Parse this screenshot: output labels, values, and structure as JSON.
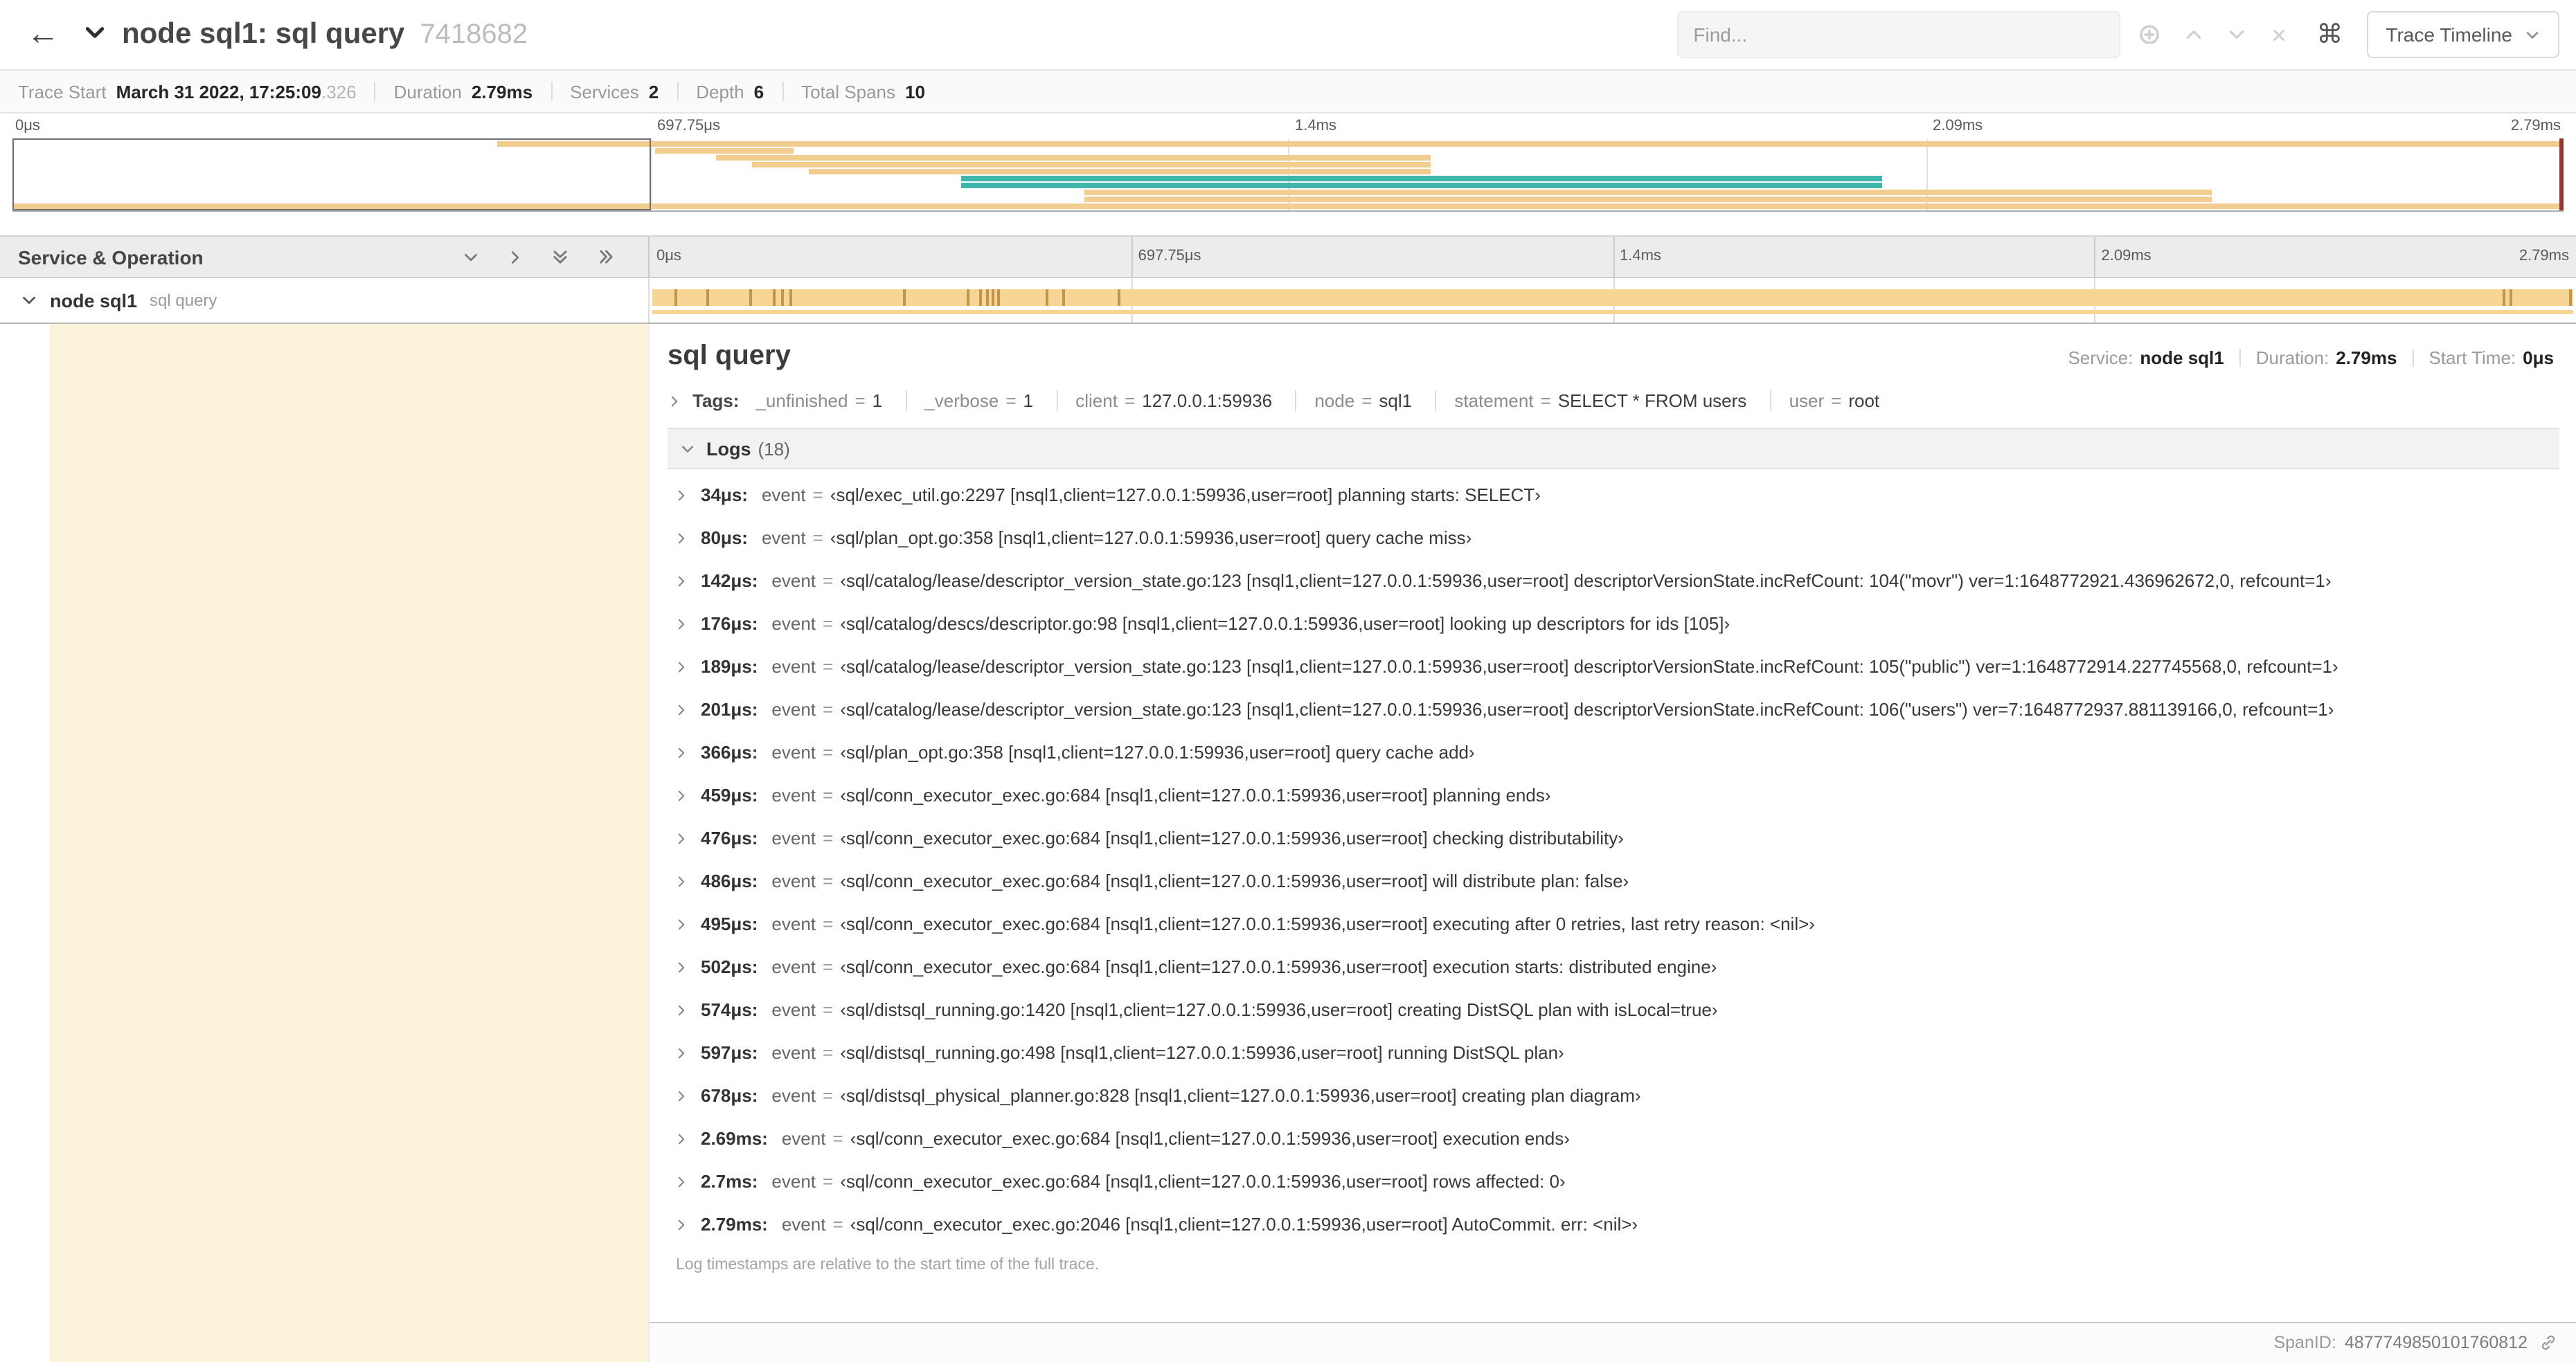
{
  "header": {
    "back_icon": "←",
    "title": "node sql1: sql query",
    "trace_id": "7418682",
    "find_placeholder": "Find...",
    "shortcuts_icon": "⌘",
    "view_selector": "Trace Timeline"
  },
  "summary": {
    "items": [
      {
        "label": "Trace Start",
        "value": "March 31 2022, 17:25:09",
        "suffix": ".326"
      },
      {
        "label": "Duration",
        "value": "2.79ms"
      },
      {
        "label": "Services",
        "value": "2"
      },
      {
        "label": "Depth",
        "value": "6"
      },
      {
        "label": "Total Spans",
        "value": "10"
      }
    ]
  },
  "timeline": {
    "service_operation_label": "Service & Operation",
    "ticks": [
      "0μs",
      "697.75μs",
      "1.4ms",
      "2.09ms",
      "2.79ms"
    ]
  },
  "minimap": {
    "selection": {
      "left_pct": 0,
      "width_pct": 25
    },
    "bars": [
      {
        "start": 19,
        "end": 100,
        "color": "#f2cd90"
      },
      {
        "start": 25.2,
        "end": 30.6,
        "color": "#f2cd90"
      },
      {
        "start": 27.6,
        "end": 55.6,
        "color": "#f2cd90"
      },
      {
        "start": 29.0,
        "end": 55.6,
        "color": "#f2cd90"
      },
      {
        "start": 31.2,
        "end": 55.6,
        "color": "#f2cd90"
      },
      {
        "start": 37.2,
        "end": 73.3,
        "color": "#3fb5ac"
      },
      {
        "start": 37.2,
        "end": 73.3,
        "color": "#3fb5ac"
      },
      {
        "start": 42.0,
        "end": 86.2,
        "color": "#f2cd90"
      },
      {
        "start": 42.0,
        "end": 86.2,
        "color": "#f2cd90"
      },
      {
        "start": 0,
        "end": 100,
        "color": "#f2cd90"
      }
    ]
  },
  "span_row": {
    "service": "node sql1",
    "operation": "sql query",
    "bar_color": "#f6d595",
    "tick_color": "#c0954c",
    "tick_pcts": [
      1.22,
      2.87,
      5.09,
      6.31,
      6.77,
      7.2,
      13.12,
      16.45,
      17.06,
      17.42,
      17.74,
      18.0,
      20.57,
      21.4,
      24.3,
      96.42,
      96.77,
      99.85
    ]
  },
  "detail": {
    "title": "sql query",
    "meta": [
      {
        "label": "Service:",
        "value": "node sql1"
      },
      {
        "label": "Duration:",
        "value": "2.79ms"
      },
      {
        "label": "Start Time:",
        "value": "0μs"
      }
    ],
    "tags_label": "Tags:",
    "tags": [
      {
        "key": "_unfinished",
        "value": "1"
      },
      {
        "key": "_verbose",
        "value": "1"
      },
      {
        "key": "client",
        "value": "127.0.0.1:59936"
      },
      {
        "key": "node",
        "value": "sql1"
      },
      {
        "key": "statement",
        "value": "SELECT * FROM users"
      },
      {
        "key": "user",
        "value": "root"
      }
    ],
    "logs_label": "Logs",
    "logs_count": "(18)",
    "logs": [
      {
        "time": "34μs:",
        "field": "event",
        "value": "‹sql/exec_util.go:2297 [nsql1,client=127.0.0.1:59936,user=root] planning starts: SELECT›"
      },
      {
        "time": "80μs:",
        "field": "event",
        "value": "‹sql/plan_opt.go:358 [nsql1,client=127.0.0.1:59936,user=root] query cache miss›"
      },
      {
        "time": "142μs:",
        "field": "event",
        "value": "‹sql/catalog/lease/descriptor_version_state.go:123 [nsql1,client=127.0.0.1:59936,user=root] descriptorVersionState.incRefCount: 104(\"movr\") ver=1:1648772921.436962672,0, refcount=1›"
      },
      {
        "time": "176μs:",
        "field": "event",
        "value": "‹sql/catalog/descs/descriptor.go:98 [nsql1,client=127.0.0.1:59936,user=root] looking up descriptors for ids [105]›"
      },
      {
        "time": "189μs:",
        "field": "event",
        "value": "‹sql/catalog/lease/descriptor_version_state.go:123 [nsql1,client=127.0.0.1:59936,user=root] descriptorVersionState.incRefCount: 105(\"public\") ver=1:1648772914.227745568,0, refcount=1›"
      },
      {
        "time": "201μs:",
        "field": "event",
        "value": "‹sql/catalog/lease/descriptor_version_state.go:123 [nsql1,client=127.0.0.1:59936,user=root] descriptorVersionState.incRefCount: 106(\"users\") ver=7:1648772937.881139166,0, refcount=1›"
      },
      {
        "time": "366μs:",
        "field": "event",
        "value": "‹sql/plan_opt.go:358 [nsql1,client=127.0.0.1:59936,user=root] query cache add›"
      },
      {
        "time": "459μs:",
        "field": "event",
        "value": "‹sql/conn_executor_exec.go:684 [nsql1,client=127.0.0.1:59936,user=root] planning ends›"
      },
      {
        "time": "476μs:",
        "field": "event",
        "value": "‹sql/conn_executor_exec.go:684 [nsql1,client=127.0.0.1:59936,user=root] checking distributability›"
      },
      {
        "time": "486μs:",
        "field": "event",
        "value": "‹sql/conn_executor_exec.go:684 [nsql1,client=127.0.0.1:59936,user=root] will distribute plan: false›"
      },
      {
        "time": "495μs:",
        "field": "event",
        "value": "‹sql/conn_executor_exec.go:684 [nsql1,client=127.0.0.1:59936,user=root] executing after 0 retries, last retry reason: <nil>›"
      },
      {
        "time": "502μs:",
        "field": "event",
        "value": "‹sql/conn_executor_exec.go:684 [nsql1,client=127.0.0.1:59936,user=root] execution starts: distributed engine›"
      },
      {
        "time": "574μs:",
        "field": "event",
        "value": "‹sql/distsql_running.go:1420 [nsql1,client=127.0.0.1:59936,user=root] creating DistSQL plan with isLocal=true›"
      },
      {
        "time": "597μs:",
        "field": "event",
        "value": "‹sql/distsql_running.go:498 [nsql1,client=127.0.0.1:59936,user=root] running DistSQL plan›"
      },
      {
        "time": "678μs:",
        "field": "event",
        "value": "‹sql/distsql_physical_planner.go:828 [nsql1,client=127.0.0.1:59936,user=root] creating plan diagram›"
      },
      {
        "time": "2.69ms:",
        "field": "event",
        "value": "‹sql/conn_executor_exec.go:684 [nsql1,client=127.0.0.1:59936,user=root] execution ends›"
      },
      {
        "time": "2.7ms:",
        "field": "event",
        "value": "‹sql/conn_executor_exec.go:684 [nsql1,client=127.0.0.1:59936,user=root] rows affected: 0›"
      },
      {
        "time": "2.79ms:",
        "field": "event",
        "value": "‹sql/conn_executor_exec.go:2046 [nsql1,client=127.0.0.1:59936,user=root] AutoCommit. err: <nil>›"
      }
    ],
    "footer_note": "Log timestamps are relative to the start time of the full trace.",
    "span_id_label": "SpanID:",
    "span_id": "4877749850101760812"
  },
  "misc": {
    "equals": "="
  },
  "colors": {
    "span_tan": "#f2cd90",
    "span_teal": "#3fb5ac",
    "tick_brown": "#c0954c",
    "detail_cream": "#fcf3db",
    "scrubber_red": "#8a3c32"
  }
}
